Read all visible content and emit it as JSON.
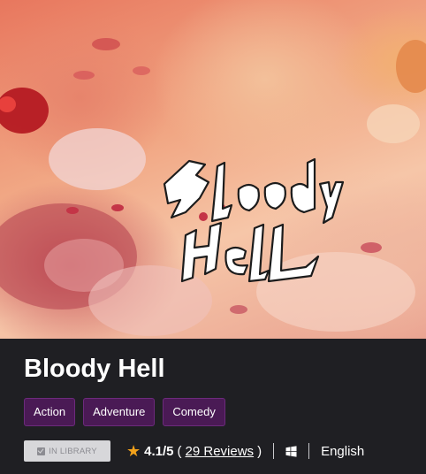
{
  "game": {
    "logo_text": "Bloody Hell",
    "title": "Bloody Hell",
    "tags": [
      "Action",
      "Adventure",
      "Comedy"
    ],
    "library_status": "IN LIBRARY",
    "rating": "4.1/5",
    "paren_open": "(",
    "reviews_label": "29 Reviews",
    "paren_close": ")",
    "platform_icon": "windows-icon",
    "language": "English"
  },
  "colors": {
    "background": "#1f1f23",
    "tag_fill": "#4a1a55",
    "tag_border": "#6d2a7d",
    "star": "#f3a21b",
    "library_button": "#d7d7da"
  }
}
